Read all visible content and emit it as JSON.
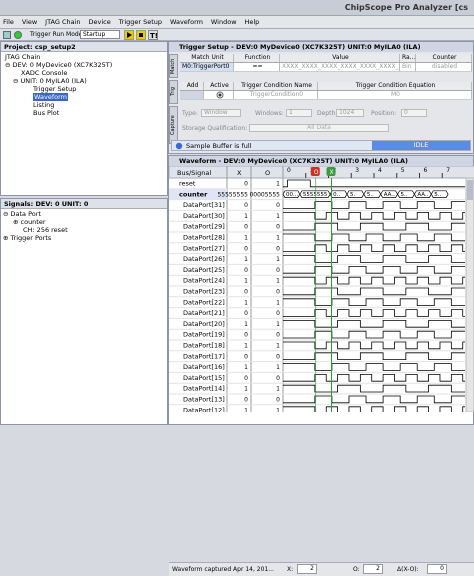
{
  "app": {
    "title": "ChipScope Pro Analyzer [cs"
  },
  "menu": [
    "File",
    "View",
    "JTAG Chain",
    "Device",
    "Trigger Setup",
    "Waveform",
    "Window",
    "Help"
  ],
  "toolbar": {
    "trigger_run_mode_label": "Trigger Run Mode:",
    "trigger_run_mode_value": "Startup"
  },
  "project": {
    "title": "Project: csp_setup2",
    "tree": [
      "JTAG Chain",
      "DEV: 0 MyDevice0 (XC7K325T)",
      "XADC Console",
      "UNIT: 0 MyILA0 (ILA)",
      "Trigger Setup",
      "Waveform",
      "Listing",
      "Bus Plot"
    ]
  },
  "signals": {
    "title": "Signals: DEV: 0 UNIT: 0",
    "tree": [
      "Data Port",
      "counter",
      "CH: 256 reset",
      "Trigger Ports"
    ]
  },
  "trigger_setup": {
    "title": "Trigger Setup - DEV:0 MyDevice0 (XC7K325T) UNIT:0 MyILA0 (ILA)",
    "tabs": [
      "Match",
      "Trig",
      "Capture"
    ],
    "match_headers": [
      "Match Unit",
      "Function",
      "Value",
      "Ra...",
      "Counter"
    ],
    "match_row": [
      "M0:TriggerPort0",
      "==",
      "XXXX_XXXX_XXXX_XXXX_XXXX_XXXX_XXXX_XXXX",
      "Bin",
      "disabled"
    ],
    "trig_headers": [
      "Add",
      "Active",
      "Trigger Condition Name",
      "Trigger Condition Equation"
    ],
    "trig_row": [
      "",
      "",
      "TriggerCondition0",
      "M0"
    ],
    "capture": {
      "type_label": "Type:",
      "type_value": "Window",
      "windows_label": "Windows:",
      "windows_value": "1",
      "depth_label": "Depth:",
      "depth_value": "1024",
      "position_label": "Position:",
      "position_value": "0",
      "storage_label": "Storage Qualification:",
      "storage_value": "All Data"
    },
    "sample_buffer": "Sample Buffer is full",
    "status": "IDLE"
  },
  "waveform": {
    "title": "Waveform - DEV:0 MyDevice0 (XC7K325T) UNIT:0 MyILA0 (ILA)",
    "headers": [
      "Bus/Signal",
      "X",
      "O"
    ],
    "ruler": [
      "0",
      "1",
      "2",
      "3",
      "4",
      "5",
      "6",
      "7"
    ],
    "cursor_x_label": "X",
    "cursor_o_label": "O",
    "rows": [
      {
        "name": "reset",
        "x": "0",
        "o": "1"
      },
      {
        "name": "counter",
        "x": "55555555",
        "o": "00005555"
      },
      {
        "name": "DataPort[31]",
        "x": "0",
        "o": "0"
      },
      {
        "name": "DataPort[30]",
        "x": "1",
        "o": "1"
      },
      {
        "name": "DataPort[29]",
        "x": "0",
        "o": "0"
      },
      {
        "name": "DataPort[28]",
        "x": "1",
        "o": "1"
      },
      {
        "name": "DataPort[27]",
        "x": "0",
        "o": "0"
      },
      {
        "name": "DataPort[26]",
        "x": "1",
        "o": "1"
      },
      {
        "name": "DataPort[25]",
        "x": "0",
        "o": "0"
      },
      {
        "name": "DataPort[24]",
        "x": "1",
        "o": "1"
      },
      {
        "name": "DataPort[23]",
        "x": "0",
        "o": "0"
      },
      {
        "name": "DataPort[22]",
        "x": "1",
        "o": "1"
      },
      {
        "name": "DataPort[21]",
        "x": "0",
        "o": "0"
      },
      {
        "name": "DataPort[20]",
        "x": "1",
        "o": "1"
      },
      {
        "name": "DataPort[19]",
        "x": "0",
        "o": "0"
      },
      {
        "name": "DataPort[18]",
        "x": "1",
        "o": "1"
      },
      {
        "name": "DataPort[17]",
        "x": "0",
        "o": "0"
      },
      {
        "name": "DataPort[16]",
        "x": "1",
        "o": "1"
      },
      {
        "name": "DataPort[15]",
        "x": "0",
        "o": "0"
      },
      {
        "name": "DataPort[14]",
        "x": "1",
        "o": "1"
      },
      {
        "name": "DataPort[13]",
        "x": "0",
        "o": "0"
      },
      {
        "name": "DataPort[12]",
        "x": "1",
        "o": "1"
      }
    ],
    "bus_values": [
      "00...",
      "5555555",
      "0..",
      "5.",
      "5..",
      "AA..",
      "5..",
      "AA..",
      "5.."
    ],
    "status_text": "Waveform captured Apr 14, 201...",
    "x_label": "X:",
    "x_value": "2",
    "o_label": "O:",
    "o_value": "2",
    "delta_label": "Δ(X-O):",
    "delta_value": "0"
  }
}
